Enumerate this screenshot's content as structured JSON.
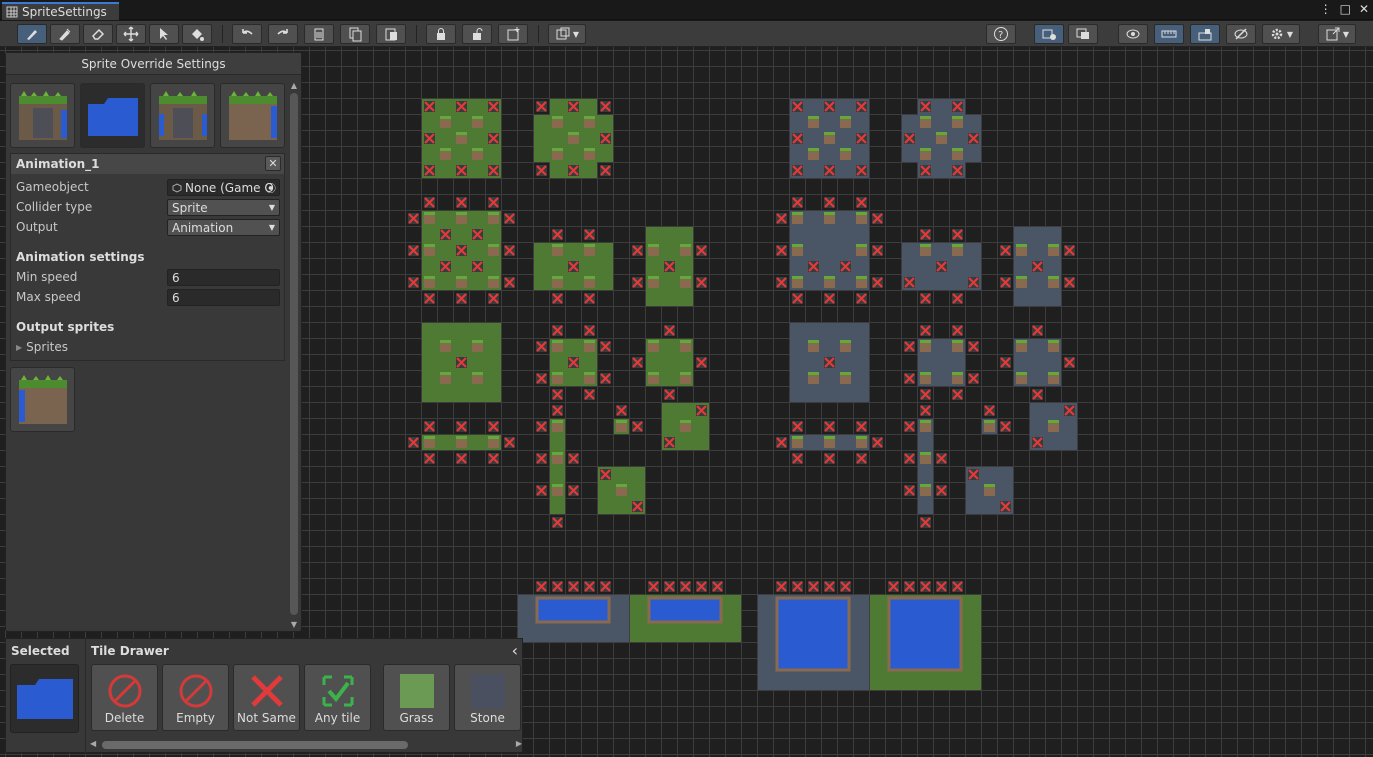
{
  "window": {
    "tab_title": "SpriteSettings",
    "menu_glyph": "⋮",
    "maximize_glyph": "□",
    "close_glyph": "✕"
  },
  "toolbar": {
    "left_tools": [
      "paint-brush-icon",
      "picker-icon",
      "eraser-icon",
      "move-icon",
      "select-icon",
      "fill-icon"
    ],
    "history": [
      "undo-icon",
      "redo-icon"
    ],
    "clipboard": [
      "delete-icon",
      "copy-icon",
      "paste-icon"
    ],
    "locks": [
      "lock-icon",
      "unlock-icon",
      "new-icon"
    ],
    "right_tools": [
      "help-icon",
      "scene-view-icon",
      "game-view-icon",
      "visibility-icon",
      "ruler-icon",
      "lock-layer-icon",
      "hide-icon",
      "settings-icon",
      "export-icon"
    ]
  },
  "override_panel": {
    "title": "Sprite Override Settings",
    "thumbnails": [
      "grass-stone-tile",
      "water-tile",
      "stone-pillar-tile",
      "grass-water-tile"
    ],
    "selected_index": 1
  },
  "inspector": {
    "name": "Animation_1",
    "close": "✕",
    "gameobject_label": "Gameobject",
    "gameobject_value": "None (Game O",
    "collider_label": "Collider type",
    "collider_value": "Sprite",
    "output_label": "Output",
    "output_value": "Animation",
    "anim_section": "Animation settings",
    "min_label": "Min speed",
    "min_value": "6",
    "max_label": "Max speed",
    "max_value": "6",
    "output_sprites_section": "Output sprites",
    "sprites_label": "Sprites"
  },
  "tile_drawer": {
    "selected_label": "Selected",
    "title": "Tile Drawer",
    "back_glyph": "‹",
    "buttons": [
      {
        "label": "Delete",
        "icon": "delete-circle-icon"
      },
      {
        "label": "Empty",
        "icon": "empty-circle-icon"
      },
      {
        "label": "Not Same",
        "icon": "not-same-x-icon"
      },
      {
        "label": "Any tile",
        "icon": "any-tile-check-icon"
      },
      {
        "label": "Grass",
        "icon": "grass-swatch-icon"
      },
      {
        "label": "Stone",
        "icon": "stone-swatch-icon"
      }
    ]
  },
  "colors": {
    "grass": "#4e7a34",
    "stone": "#4a5566",
    "water": "#2a5bd0",
    "cross": "#e03a3a",
    "accent": "#3a7bd5"
  }
}
